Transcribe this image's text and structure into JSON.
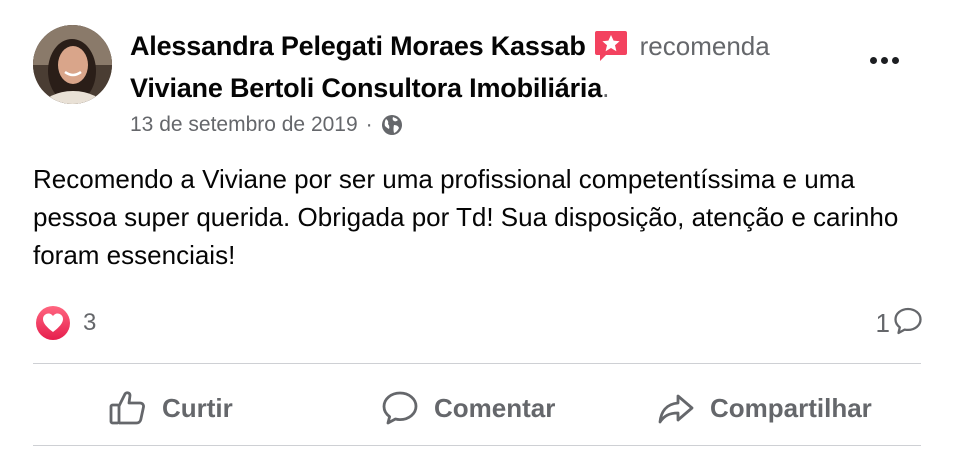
{
  "post": {
    "author": "Alessandra Pelegati Moraes Kassab",
    "verb": "recomenda",
    "page": "Viviane Bertoli Consultora Imobiliária",
    "period": ".",
    "date": "13 de setembro de 2019",
    "separator": "·",
    "body": "Recomendo a Viviane por ser uma profissional competentíssima e uma pessoa super querida. Obrigada por Td! Sua disposição, atenção e carinho foram essenciais!",
    "icons": {
      "recommendation": "recommend-star-icon",
      "audience": "globe-icon",
      "more": "more-options-icon"
    }
  },
  "stats": {
    "reactions_count": "3",
    "reaction_type": "love",
    "comments_count": "1"
  },
  "actions": {
    "like": "Curtir",
    "comment": "Comentar",
    "share": "Compartilhar"
  },
  "colors": {
    "text_primary": "#050505",
    "text_secondary": "#65676b",
    "recommend_badge": "#f3425f",
    "heart": "#f33e58",
    "divider": "#ced0d4"
  }
}
